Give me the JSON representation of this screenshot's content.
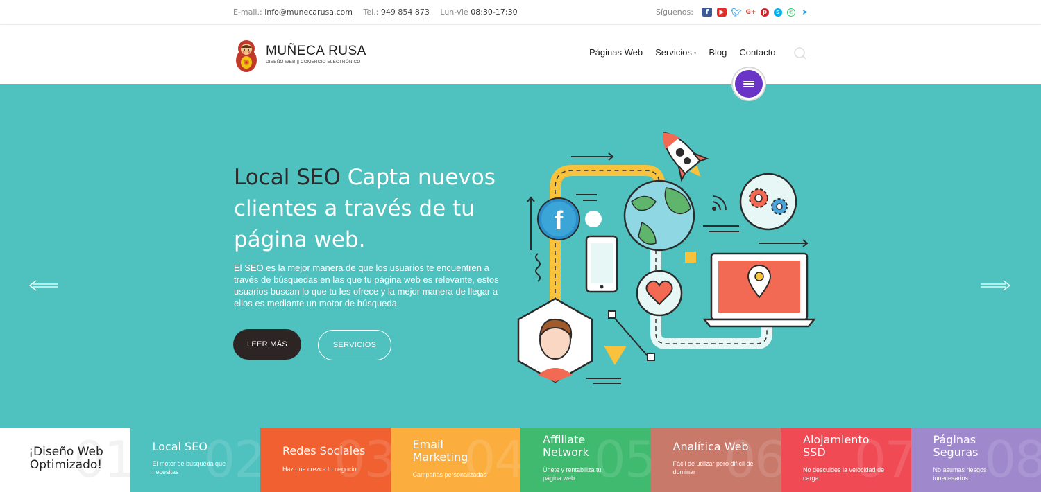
{
  "topbar": {
    "email_label": "E-mail.:",
    "email": "info@munecarusa.com",
    "phone_label": "Tel.:",
    "phone": "949 854 873",
    "hours_label": "Lun-Vie",
    "hours": "08:30-17:30",
    "social_label": "Síguenos:",
    "social_icons": [
      "facebook-icon",
      "youtube-icon",
      "twitter-icon",
      "google-plus-icon",
      "pinterest-icon",
      "skype-icon",
      "whatsapp-icon",
      "telegram-icon"
    ]
  },
  "header": {
    "brand_name": "MUÑECA RUSA",
    "brand_tagline": "DISEÑO WEB || COMERCIO ELECTRÓNICO",
    "nav": [
      "Páginas Web",
      "Servicios",
      "Blog",
      "Contacto"
    ]
  },
  "hero": {
    "title_dark": "Local SEO",
    "title_light": " Capta nuevos clientes a través de tu página web.",
    "description": "El SEO es la mejor manera de que los usuarios te encuentren a través de búsquedas en las que tu página web es relevante, estos usuarios buscan lo que tu les ofrece y la mejor manera de llegar a ellos es mediante un motor de búsqueda.",
    "primary_button": "LEER MÁS",
    "secondary_button": "SERVICIOS"
  },
  "tiles": [
    {
      "num": "01",
      "title": "¡Diseño Web Optimizado!",
      "subtitle": "",
      "color": "#ffffff"
    },
    {
      "num": "02",
      "title": "Local SEO",
      "subtitle": "El motor de búsqueda que necesitas",
      "color": "#4fc1bf"
    },
    {
      "num": "03",
      "title": "Redes Sociales",
      "subtitle": "Haz que crezca tu negocio",
      "color": "#f06031"
    },
    {
      "num": "04",
      "title": "Email Marketing",
      "subtitle": "Campañas personalizadas",
      "color": "#fbae3e"
    },
    {
      "num": "05",
      "title": "Affiliate Network",
      "subtitle": "Únete y rentabiliza tu página web",
      "color": "#3fba6f"
    },
    {
      "num": "06",
      "title": "Analítica Web",
      "subtitle": "Fácil de utilizar pero difícil de dominar",
      "color": "#c9796a"
    },
    {
      "num": "07",
      "title": "Alojamiento SSD",
      "subtitle": "No descuides la velocidad de carga",
      "color": "#f04a55"
    },
    {
      "num": "08",
      "title": "Páginas Seguras",
      "subtitle": "No asumas riesgos innecesarios",
      "color": "#9f88cc"
    }
  ],
  "colors": {
    "hero_bg": "#4fc1bf",
    "accent_purple": "#6a35c6",
    "dark_button": "#2d2424"
  }
}
